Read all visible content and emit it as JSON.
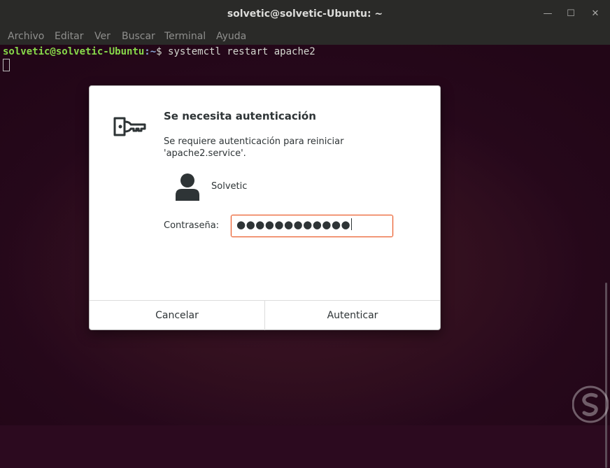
{
  "window": {
    "title": "solvetic@solvetic-Ubuntu: ~",
    "controls": {
      "minimize": "—",
      "maximize": "☐",
      "close": "✕"
    }
  },
  "menu": [
    "Archivo",
    "Editar",
    "Ver",
    "Buscar",
    "Terminal",
    "Ayuda"
  ],
  "terminal": {
    "prompt_user": "solvetic@solvetic-Ubuntu",
    "prompt_path": ":~",
    "prompt_symbol": "$ ",
    "command": "systemctl restart apache2"
  },
  "dialog": {
    "title": "Se necesita autenticación",
    "message": "Se requiere autenticación para reiniciar 'apache2.service'.",
    "user": "Solvetic",
    "password_label": "Contraseña:",
    "password_mask": "●●●●●●●●●●●●",
    "cancel_label": "Cancelar",
    "authenticate_label": "Autenticar",
    "accent_color": "#e95420"
  },
  "icons": {
    "dialog": "key-icon",
    "user": "user-avatar-icon",
    "watermark": "solvetic-logo"
  }
}
